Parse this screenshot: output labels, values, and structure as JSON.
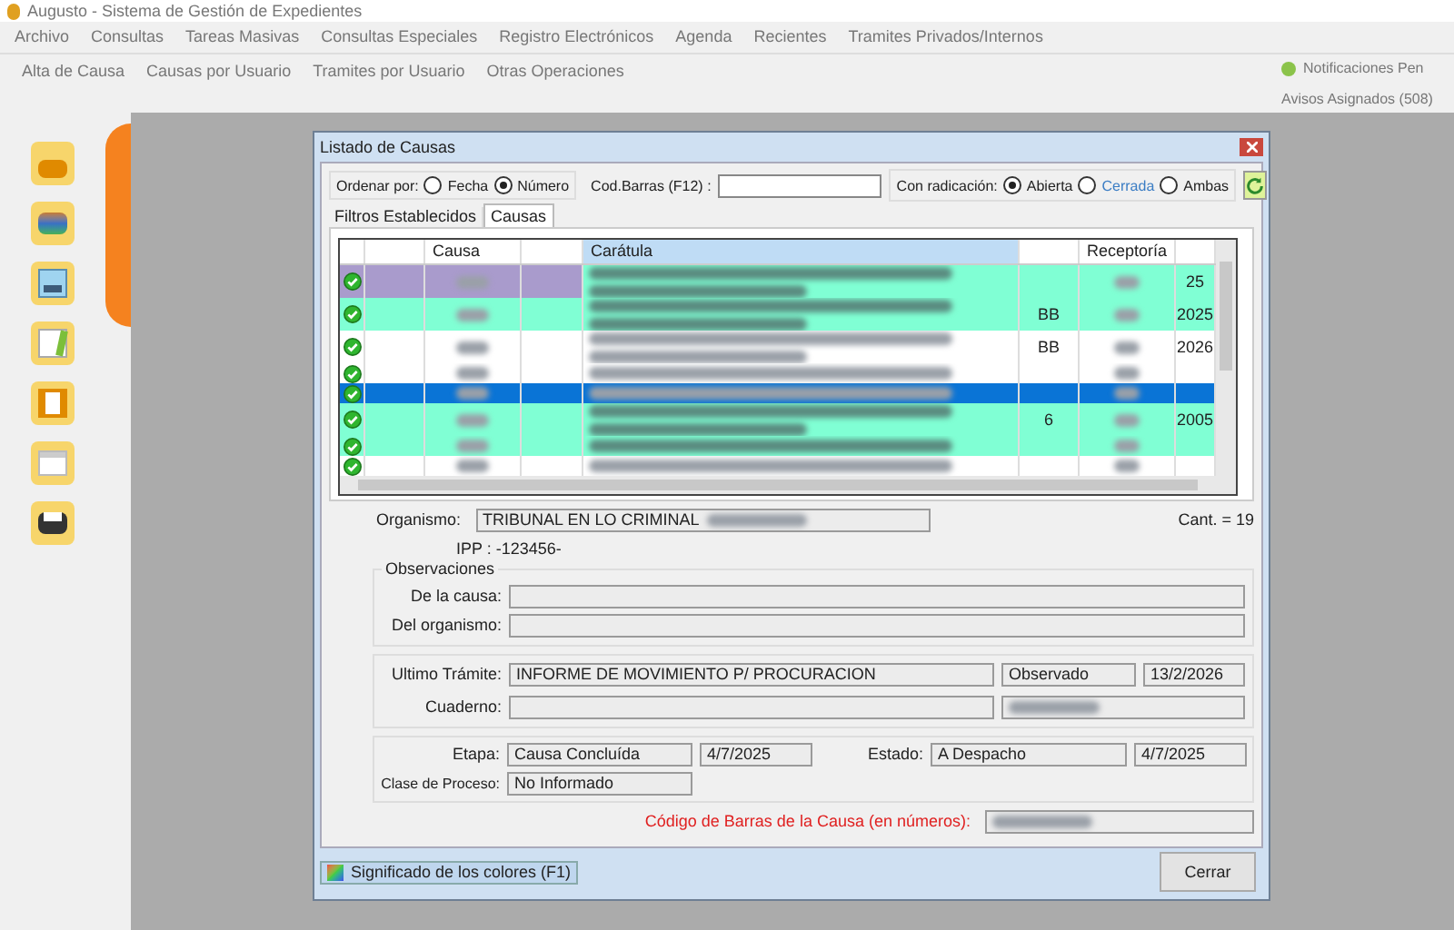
{
  "app": {
    "title": "Augusto - Sistema de Gestión de Expedientes",
    "menu": [
      "Archivo",
      "Consultas",
      "Tareas Masivas",
      "Consultas Especiales",
      "Registro Electrónicos",
      "Agenda",
      "Recientes",
      "Tramites Privados/Internos"
    ],
    "toolbar_tabs": [
      "Alta de Causa",
      "Causas por Usuario",
      "Tramites por Usuario",
      "Otras Operaciones"
    ],
    "notifications": "Notificaciones Pen",
    "notices": "Avisos Asignados (508)",
    "sidebar_icons": [
      {
        "kind": "box"
      },
      {
        "kind": "book"
      },
      {
        "kind": "window"
      },
      {
        "kind": "pencil"
      },
      {
        "kind": "document"
      },
      {
        "kind": "calendar"
      },
      {
        "kind": "printer"
      }
    ]
  },
  "dialog": {
    "title": "Listado de Causas",
    "order": {
      "label": "Ordenar por:",
      "options": [
        {
          "label": "Fecha",
          "selected": false
        },
        {
          "label": "Número",
          "selected": true
        }
      ]
    },
    "barcode": {
      "label": "Cod.Barras (F12) :"
    },
    "radication": {
      "label": "Con radicación:",
      "options": [
        {
          "label": "Abierta",
          "selected": true,
          "highlight": false
        },
        {
          "label": "Cerrada",
          "selected": false,
          "highlight": true
        },
        {
          "label": "Ambas",
          "selected": false,
          "highlight": false
        }
      ]
    },
    "tabs": [
      {
        "label": "Filtros Establecidos",
        "selected": false
      },
      {
        "label": "Causas",
        "selected": true
      }
    ],
    "table": {
      "columns": [
        {
          "kind": "icon",
          "sorted": false
        },
        {
          "kind": "blank",
          "sorted": false
        },
        {
          "kind": "text",
          "label": "Causa",
          "sorted": false
        },
        {
          "kind": "blank",
          "sorted": false
        },
        {
          "kind": "text",
          "label": "Carátula",
          "sorted": true
        },
        {
          "kind": "blank",
          "sorted": false
        },
        {
          "kind": "text",
          "label": "Receptoría",
          "sorted": false
        },
        {
          "kind": "blank",
          "sorted": false
        }
      ],
      "rows": [
        {
          "selected": false,
          "color": "#80ffd4",
          "marked": true,
          "wraps": true,
          "col_6": "",
          "col_8": "25"
        },
        {
          "selected": false,
          "color": "#80ffd4",
          "marked": false,
          "wraps": true,
          "col_6": "BB",
          "col_8": "2025"
        },
        {
          "selected": false,
          "color": "#ffffff",
          "marked": false,
          "wraps": true,
          "col_6": "BB",
          "col_8": "2026"
        },
        {
          "selected": false,
          "color": "#ffffff",
          "marked": false,
          "wraps": false,
          "col_6": "",
          "col_8": ""
        },
        {
          "selected": true,
          "wraps": false,
          "col_6": "",
          "col_8": ""
        },
        {
          "selected": false,
          "color": "#80ffd4",
          "marked": false,
          "wraps": true,
          "col_6": "6",
          "col_8": "2005"
        },
        {
          "selected": false,
          "color": "#80ffd4",
          "marked": false,
          "wraps": false,
          "col_6": "",
          "col_8": ""
        },
        {
          "selected": false,
          "color": "#ffffff",
          "marked": false,
          "wraps": false,
          "col_6": "",
          "col_8": ""
        }
      ]
    },
    "organismo": {
      "label": "Organismo:",
      "value": "TRIBUNAL EN LO CRIMINAL"
    },
    "count": "Cant. = 19",
    "ipp": "IPP : -123456-",
    "observaciones": {
      "title": "Observaciones",
      "fields": [
        {
          "label": "De la causa:"
        },
        {
          "label": "Del organismo:"
        }
      ]
    },
    "tramite": {
      "label": "Ultimo Trámite:",
      "value": "INFORME DE MOVIMIENTO P/ PROCURACION",
      "status": "Observado",
      "date": "13/2/2026",
      "cuaderno_label": "Cuaderno:"
    },
    "etapa": {
      "label": "Etapa:",
      "value": "Causa Concluída",
      "date": "4/7/2025",
      "estado_label": "Estado:",
      "estado": "A Despacho",
      "estado_date": "4/7/2025",
      "clase_label": "Clase de Proceso:",
      "clase": "No Informado"
    },
    "barcode_causa": {
      "label": "Código de Barras de la Causa (en números):"
    },
    "colors_button": "Significado de los colores (F1)",
    "close_button": "Cerrar"
  }
}
